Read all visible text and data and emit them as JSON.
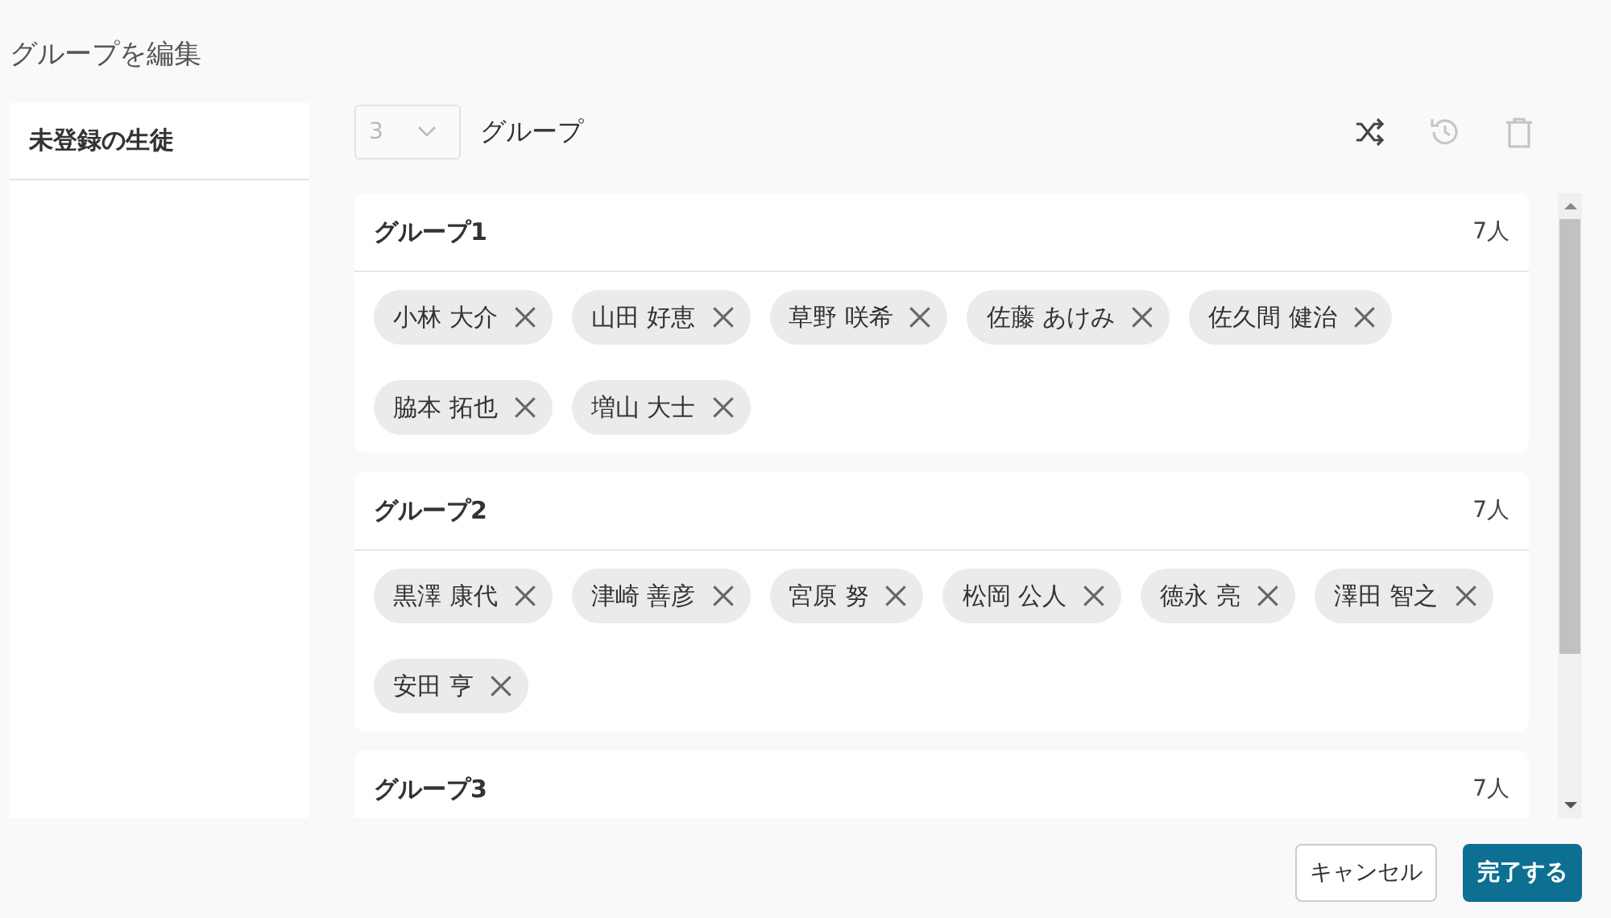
{
  "title": "グループを編集",
  "sidebar": {
    "heading": "未登録の生徒"
  },
  "toolbar": {
    "group_count": {
      "value": "3",
      "disabled": true
    },
    "unit_label": "グループ",
    "actions": [
      {
        "kind": "shuffle",
        "disabled": false
      },
      {
        "kind": "history",
        "disabled": true
      },
      {
        "kind": "delete",
        "disabled": true
      }
    ]
  },
  "groups": [
    {
      "name": "グループ1",
      "count": "7人",
      "members": [
        "小林 大介",
        "山田 好恵",
        "草野 咲希",
        "佐藤 あけみ",
        "佐久間 健治",
        "脇本 拓也",
        "増山 大士"
      ]
    },
    {
      "name": "グループ2",
      "count": "7人",
      "members": [
        "黒澤 康代",
        "津崎 善彦",
        "宮原 努",
        "松岡 公人",
        "徳永 亮",
        "澤田 智之",
        "安田 亨"
      ]
    },
    {
      "name": "グループ3",
      "count": "7人"
    }
  ],
  "buttons": [
    {
      "label": "キャンセル",
      "kind": "secondary"
    },
    {
      "label": "完了する",
      "kind": "primary"
    }
  ]
}
